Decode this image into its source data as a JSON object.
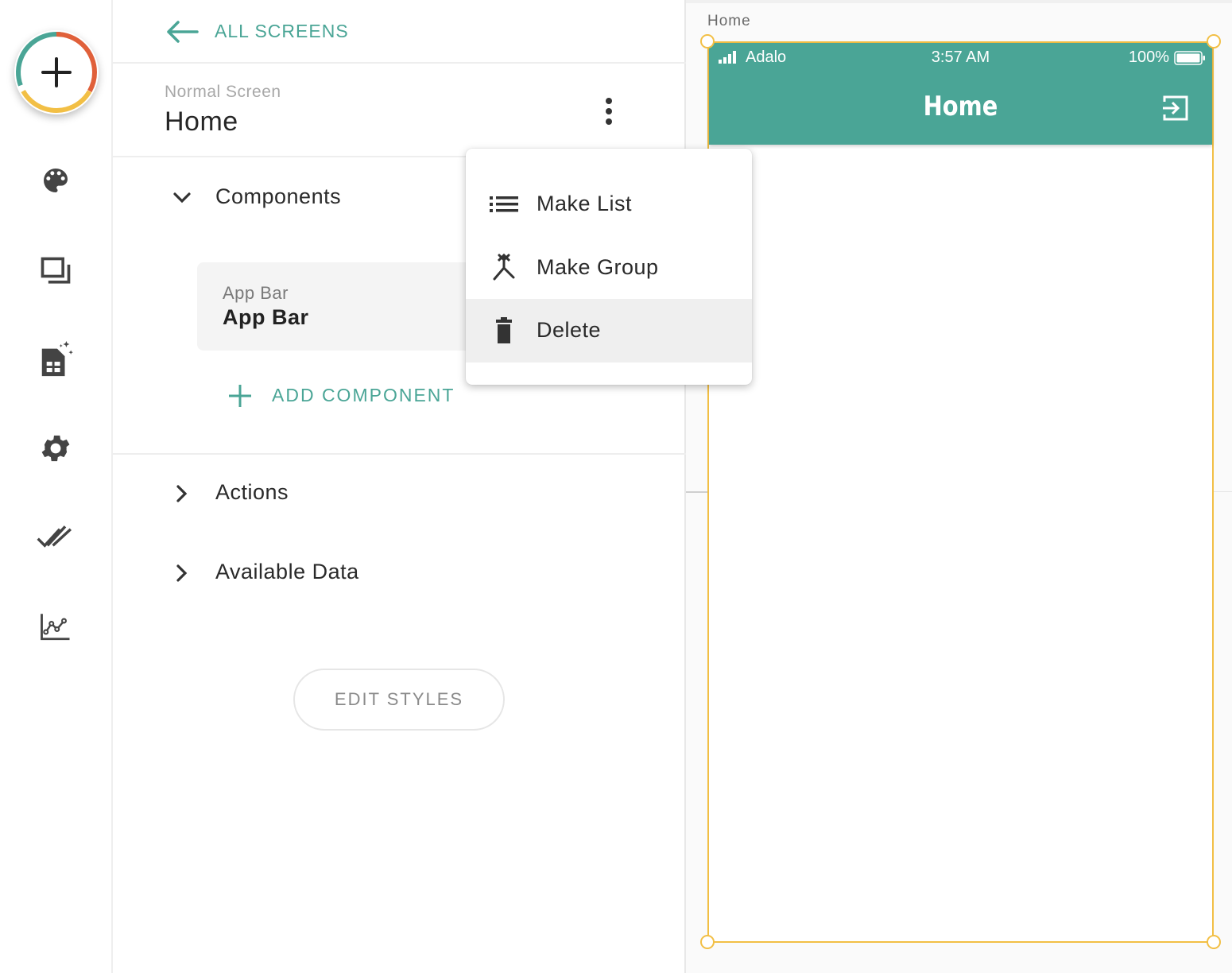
{
  "nav": {
    "back_label": "ALL SCREENS"
  },
  "screen": {
    "type": "Normal Screen",
    "name": "Home"
  },
  "sections": {
    "components": "Components",
    "actions": "Actions",
    "available_data": "Available Data"
  },
  "components": [
    {
      "type": "App Bar",
      "name": "App Bar"
    }
  ],
  "add_component_label": "ADD COMPONENT",
  "edit_styles_label": "EDIT STYLES",
  "context_menu": {
    "items": [
      {
        "label": "Make List",
        "icon": "list-icon"
      },
      {
        "label": "Make Group",
        "icon": "merge-icon"
      },
      {
        "label": "Delete",
        "icon": "trash-icon",
        "highlighted": true
      }
    ]
  },
  "canvas": {
    "frame_label": "Home",
    "status_bar": {
      "carrier": "Adalo",
      "time": "3:57 AM",
      "battery": "100%"
    },
    "app_bar_title": "Home"
  },
  "colors": {
    "accent": "#4aa596",
    "selection": "#f2bf45",
    "fab_ring": [
      "#4aa596",
      "#e0603a",
      "#f2bf45"
    ]
  },
  "rail_icons": [
    "add-icon",
    "palette-icon",
    "screens-icon",
    "database-icon",
    "settings-icon",
    "publish-icon",
    "analytics-icon"
  ]
}
